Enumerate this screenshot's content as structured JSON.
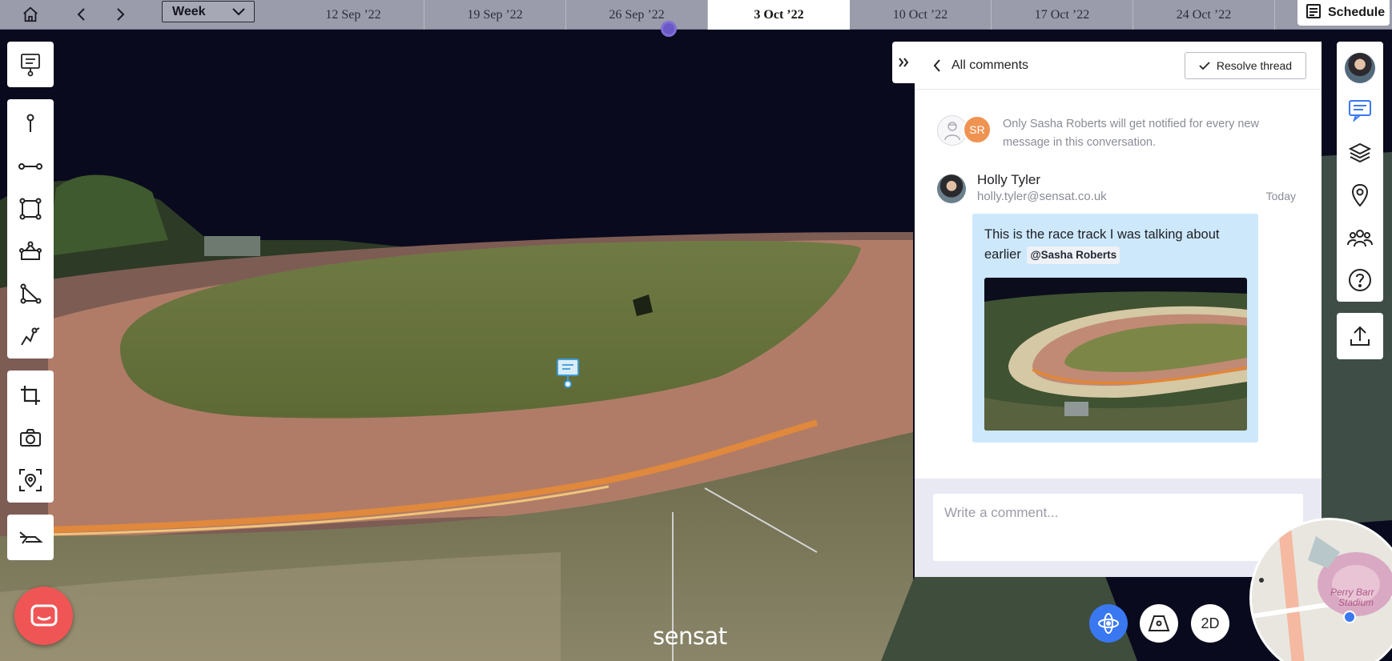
{
  "topbar": {
    "home_icon": "home-icon",
    "week_select": "Week",
    "dates": [
      "12 Sep ’22",
      "19 Sep ’22",
      "26 Sep ’22",
      "3 Oct ’22",
      "10 Oct ’22",
      "17 Oct ’22",
      "24 Oct ’22"
    ],
    "active_date_index": 3,
    "schedule_label": "Schedule"
  },
  "comments": {
    "back_label": "All comments",
    "resolve_label": "Resolve thread",
    "notify_initials": "SR",
    "notify_text": "Only Sasha Roberts will get notified for every new message in this conversation.",
    "message": {
      "author": "Holly Tyler",
      "email": "holly.tyler@sensat.co.uk",
      "time": "Today",
      "text": "This is the race track I was talking about earlier",
      "mention": "@Sasha Roberts"
    },
    "composer_placeholder": "Write a comment..."
  },
  "bottom": {
    "mode_2d": "2D",
    "logo": "sensat"
  },
  "minimap": {
    "label_1": "Perry Barr",
    "label_2": "Stadium"
  },
  "colors": {
    "accent_blue": "#3a78f2",
    "mention_bg": "#eef1f6",
    "bubble_bg": "#cde8fb",
    "launcher_red": "#f05555",
    "timeline_bg": "#9a9cab"
  }
}
